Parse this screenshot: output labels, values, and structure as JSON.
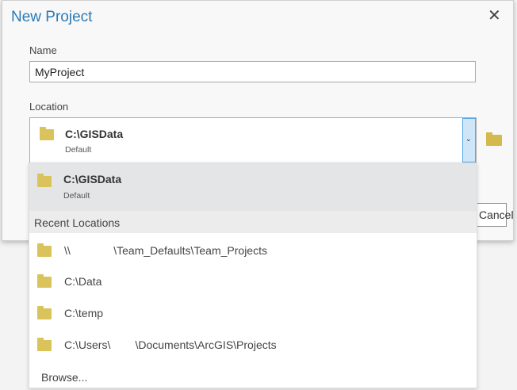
{
  "dialog": {
    "title": "New Project",
    "close_label": "✕"
  },
  "name": {
    "label": "Name",
    "value": "MyProject"
  },
  "location": {
    "label": "Location",
    "selected": {
      "path": "C:\\GISData",
      "sub": "Default"
    },
    "dropdown_arrow": "⌄"
  },
  "cancel_label": "Cancel",
  "dropdown": {
    "current": {
      "path": "C:\\GISData",
      "sub": "Default"
    },
    "header": "Recent Locations",
    "items": [
      "\\\\              \\Team_Defaults\\Team_Projects",
      "C:\\Data",
      "C:\\temp",
      "C:\\Users\\        \\Documents\\ArcGIS\\Projects"
    ],
    "browse": "Browse..."
  }
}
